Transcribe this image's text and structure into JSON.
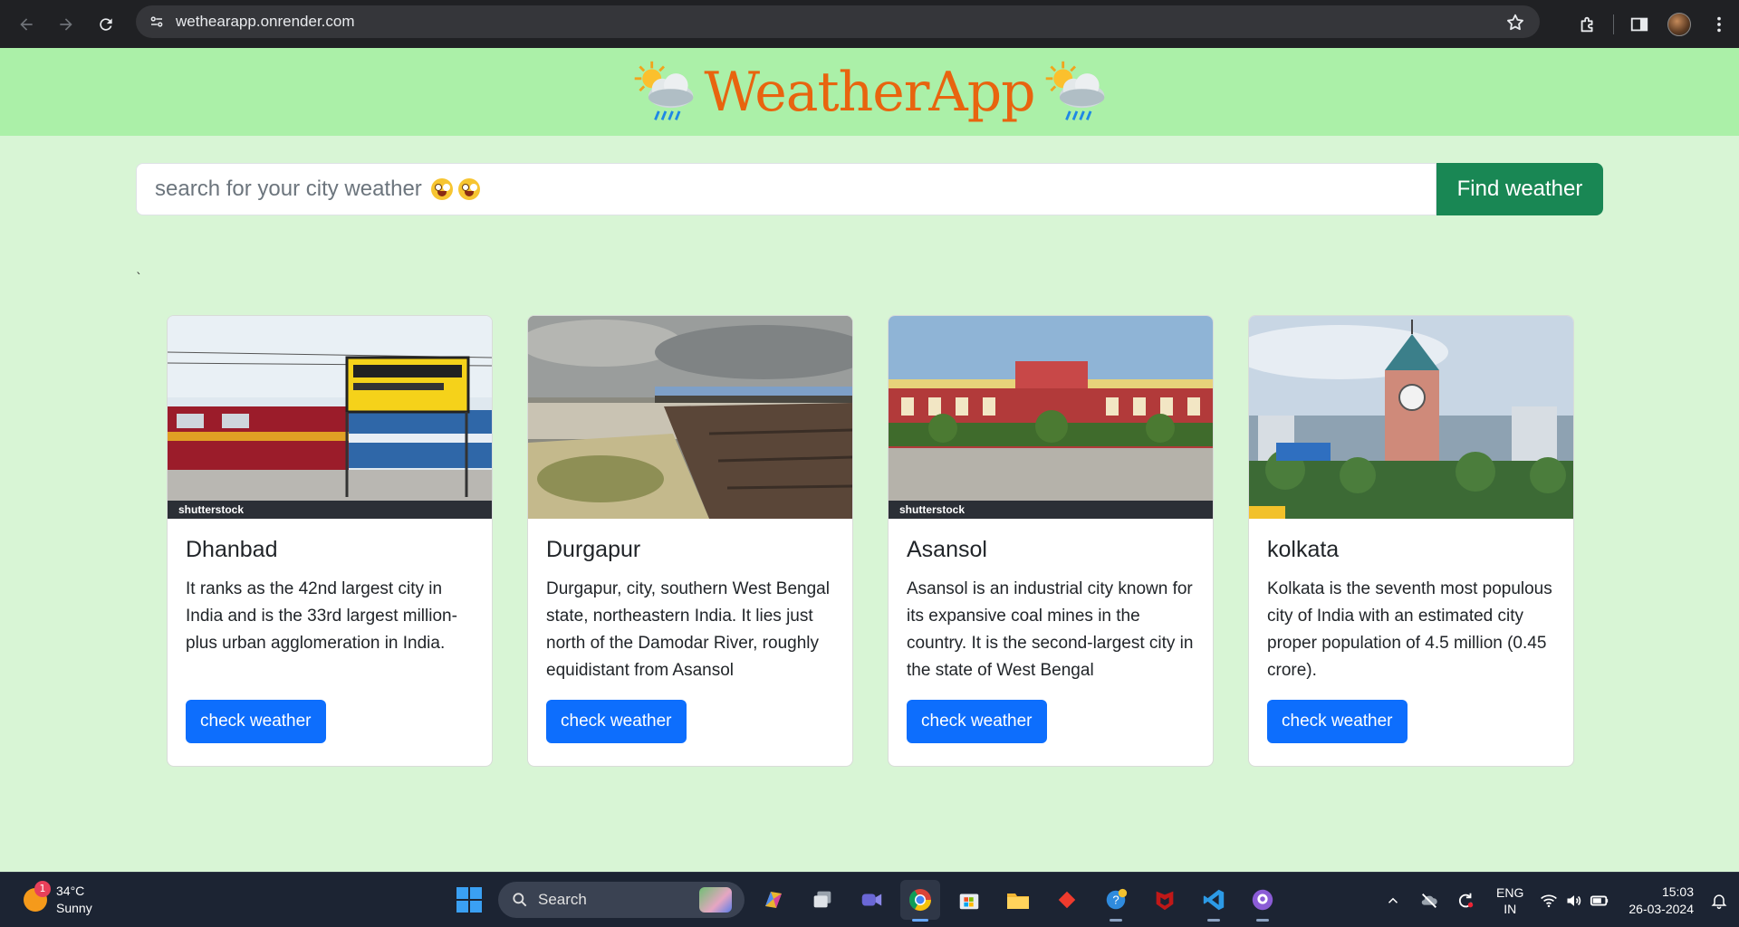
{
  "browser": {
    "url": "wethearapp.onrender.com"
  },
  "app": {
    "title": "WeatherApp",
    "search": {
      "placeholder": "search for your city weather",
      "button_label": "Find weather"
    },
    "stray_mark": "`",
    "cards": [
      {
        "city": "Dhanbad",
        "description": "It ranks as the 42nd largest city in India and is the 33rd largest million-plus urban agglomeration in India.",
        "button_label": "check weather",
        "watermark": "shutterstock"
      },
      {
        "city": "Durgapur",
        "description": "Durgapur, city, southern West Bengal state, northeastern India. It lies just north of the Damodar River, roughly equidistant from Asansol",
        "button_label": "check weather",
        "watermark": ""
      },
      {
        "city": "Asansol",
        "description": "Asansol is an industrial city known for its expansive coal mines in the country. It is the second-largest city in the state of West Bengal",
        "button_label": "check weather",
        "watermark": "shutterstock"
      },
      {
        "city": "kolkata",
        "description": "Kolkata is the seventh most populous city of India with an estimated city proper population of 4.5 million (0.45 crore).",
        "button_label": "check weather",
        "watermark": ""
      }
    ]
  },
  "taskbar": {
    "weather_temp": "34°C",
    "weather_desc": "Sunny",
    "notification_count": "1",
    "search_label": "Search",
    "lang_line1": "ENG",
    "lang_line2": "IN",
    "time": "15:03",
    "date": "26-03-2024"
  },
  "colors": {
    "header_bg": "#abf0a8",
    "page_bg": "#d8f5d5",
    "title": "#e8640f",
    "find_button": "#198754",
    "card_button": "#0d6efd"
  }
}
